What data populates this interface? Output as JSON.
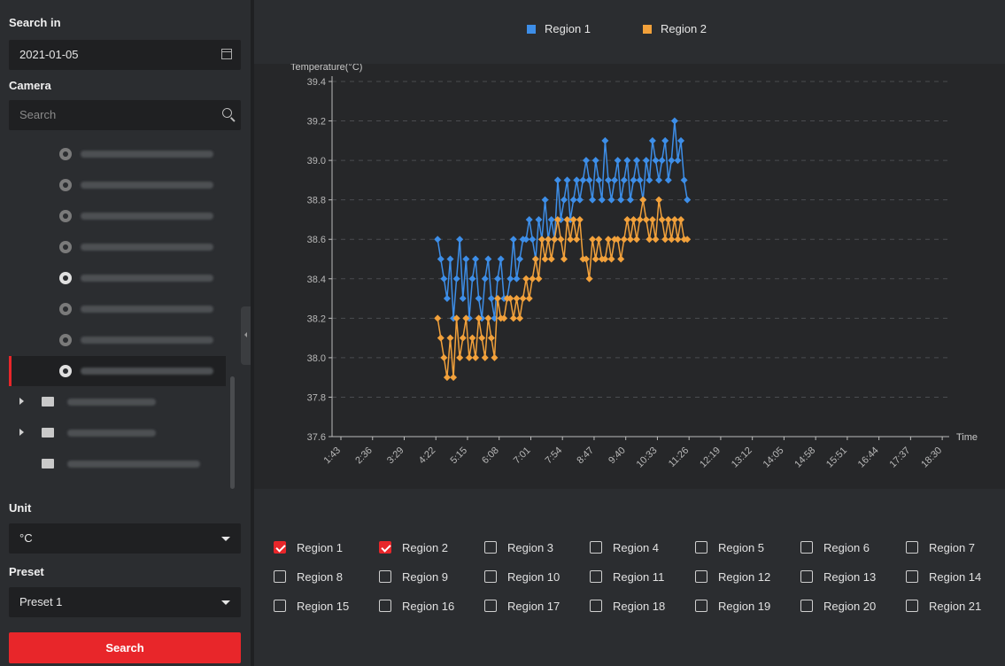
{
  "sidebar": {
    "search_in_label": "Search in",
    "date_value": "2021-01-05",
    "camera_label": "Camera",
    "camera_search_placeholder": "Search",
    "cameras": [
      {
        "active": false
      },
      {
        "active": false
      },
      {
        "active": false
      },
      {
        "active": false
      },
      {
        "active": true
      },
      {
        "active": false
      },
      {
        "active": false
      },
      {
        "active": true,
        "selected": true
      }
    ],
    "folders": [
      {
        "expandable": true
      },
      {
        "expandable": true
      },
      {
        "expandable": false
      }
    ],
    "unit_label": "Unit",
    "unit_value": "°C",
    "preset_label": "Preset",
    "preset_value": "Preset 1",
    "search_button": "Search"
  },
  "legend": [
    {
      "name": "Region 1",
      "color": "#3d8ee8"
    },
    {
      "name": "Region 2",
      "color": "#f2a13b"
    }
  ],
  "chart_data": {
    "type": "line",
    "ylabel": "Temperature(°C)",
    "xlabel": "Time",
    "ylim": [
      37.6,
      39.4
    ],
    "yticks": [
      "39.4",
      "39.2",
      "39.0",
      "38.8",
      "38.6",
      "38.4",
      "38.2",
      "38.0",
      "37.8",
      "37.6"
    ],
    "xticks": [
      "1:43",
      "2:36",
      "3:29",
      "4:22",
      "5:15",
      "6:08",
      "7:01",
      "7:54",
      "8:47",
      "9:40",
      "10:33",
      "11:26",
      "12:19",
      "13:12",
      "14:05",
      "14:58",
      "15:51",
      "16:44",
      "17:37",
      "18:30"
    ],
    "grid": true,
    "series": [
      {
        "name": "Region 1",
        "color": "#3d8ee8",
        "x_start": "4:22",
        "x_end": "11:26",
        "values": [
          38.6,
          38.5,
          38.4,
          38.3,
          38.5,
          38.2,
          38.4,
          38.6,
          38.3,
          38.5,
          38.2,
          38.4,
          38.5,
          38.3,
          38.2,
          38.4,
          38.5,
          38.3,
          38.2,
          38.4,
          38.5,
          38.3,
          38.3,
          38.4,
          38.6,
          38.4,
          38.5,
          38.6,
          38.6,
          38.7,
          38.6,
          38.5,
          38.7,
          38.6,
          38.8,
          38.6,
          38.7,
          38.6,
          38.9,
          38.7,
          38.8,
          38.9,
          38.7,
          38.8,
          38.9,
          38.8,
          38.9,
          39.0,
          38.9,
          38.8,
          39.0,
          38.9,
          38.8,
          39.1,
          38.9,
          38.8,
          38.9,
          39.0,
          38.8,
          38.9,
          39.0,
          38.8,
          38.9,
          39.0,
          38.9,
          38.8,
          39.0,
          38.9,
          39.1,
          39.0,
          38.9,
          39.0,
          39.1,
          38.9,
          39.0,
          39.2,
          39.0,
          39.1,
          38.9,
          38.8
        ]
      },
      {
        "name": "Region 2",
        "color": "#f2a13b",
        "x_start": "4:22",
        "x_end": "11:26",
        "values": [
          38.2,
          38.1,
          38.0,
          37.9,
          38.1,
          37.9,
          38.2,
          38.0,
          38.1,
          38.2,
          38.0,
          38.1,
          38.0,
          38.2,
          38.1,
          38.0,
          38.2,
          38.1,
          38.0,
          38.3,
          38.2,
          38.2,
          38.3,
          38.3,
          38.2,
          38.3,
          38.2,
          38.3,
          38.4,
          38.3,
          38.4,
          38.5,
          38.4,
          38.6,
          38.5,
          38.6,
          38.5,
          38.6,
          38.7,
          38.6,
          38.5,
          38.7,
          38.6,
          38.7,
          38.6,
          38.7,
          38.5,
          38.5,
          38.4,
          38.6,
          38.5,
          38.6,
          38.5,
          38.5,
          38.6,
          38.5,
          38.6,
          38.6,
          38.5,
          38.6,
          38.7,
          38.6,
          38.7,
          38.6,
          38.7,
          38.8,
          38.7,
          38.6,
          38.7,
          38.6,
          38.8,
          38.7,
          38.6,
          38.7,
          38.6,
          38.7,
          38.6,
          38.7,
          38.6,
          38.6
        ]
      }
    ]
  },
  "regions": [
    {
      "label": "Region 1",
      "checked": true
    },
    {
      "label": "Region 2",
      "checked": true
    },
    {
      "label": "Region 3",
      "checked": false
    },
    {
      "label": "Region 4",
      "checked": false
    },
    {
      "label": "Region 5",
      "checked": false
    },
    {
      "label": "Region 6",
      "checked": false
    },
    {
      "label": "Region 7",
      "checked": false
    },
    {
      "label": "Region 8",
      "checked": false
    },
    {
      "label": "Region 9",
      "checked": false
    },
    {
      "label": "Region 10",
      "checked": false
    },
    {
      "label": "Region 11",
      "checked": false
    },
    {
      "label": "Region 12",
      "checked": false
    },
    {
      "label": "Region 13",
      "checked": false
    },
    {
      "label": "Region 14",
      "checked": false
    },
    {
      "label": "Region 15",
      "checked": false
    },
    {
      "label": "Region 16",
      "checked": false
    },
    {
      "label": "Region 17",
      "checked": false
    },
    {
      "label": "Region 18",
      "checked": false
    },
    {
      "label": "Region 19",
      "checked": false
    },
    {
      "label": "Region 20",
      "checked": false
    },
    {
      "label": "Region 21",
      "checked": false
    }
  ]
}
